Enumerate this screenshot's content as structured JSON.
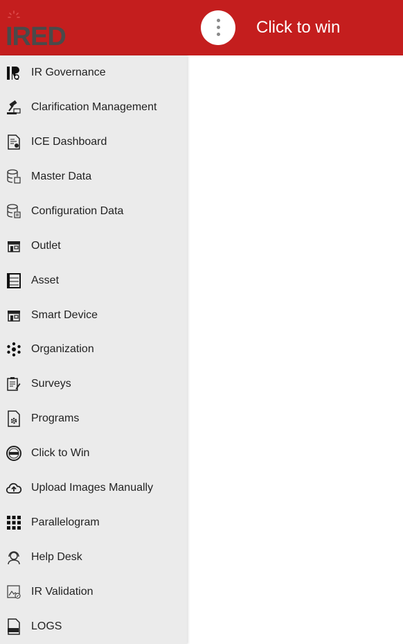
{
  "header": {
    "logo_text": "IRED",
    "title": "Click to win",
    "menu_icon": "more-vertical-icon",
    "background_color": "#c41e1e"
  },
  "sidebar": {
    "items": [
      {
        "label": "IR Governance",
        "icon": "ir-governance-icon"
      },
      {
        "label": "Clarification Management",
        "icon": "gavel-icon"
      },
      {
        "label": "ICE Dashboard",
        "icon": "document-chart-icon"
      },
      {
        "label": "Master Data",
        "icon": "database-icon"
      },
      {
        "label": "Configuration Data",
        "icon": "database-config-icon"
      },
      {
        "label": "Outlet",
        "icon": "storefront-icon"
      },
      {
        "label": "Asset",
        "icon": "cooler-icon"
      },
      {
        "label": "Smart Device",
        "icon": "storefront-device-icon"
      },
      {
        "label": "Organization",
        "icon": "organization-icon"
      },
      {
        "label": "Surveys",
        "icon": "clipboard-edit-icon"
      },
      {
        "label": "Programs",
        "icon": "document-gear-icon"
      },
      {
        "label": "Click to Win",
        "icon": "ctw-badge-icon"
      },
      {
        "label": "Upload Images Manually",
        "icon": "cloud-upload-icon"
      },
      {
        "label": "Parallelogram",
        "icon": "grid-icon"
      },
      {
        "label": "Help Desk",
        "icon": "support-agent-icon"
      },
      {
        "label": "IR Validation",
        "icon": "image-check-icon"
      },
      {
        "label": "LOGS",
        "icon": "log-file-icon"
      }
    ]
  }
}
